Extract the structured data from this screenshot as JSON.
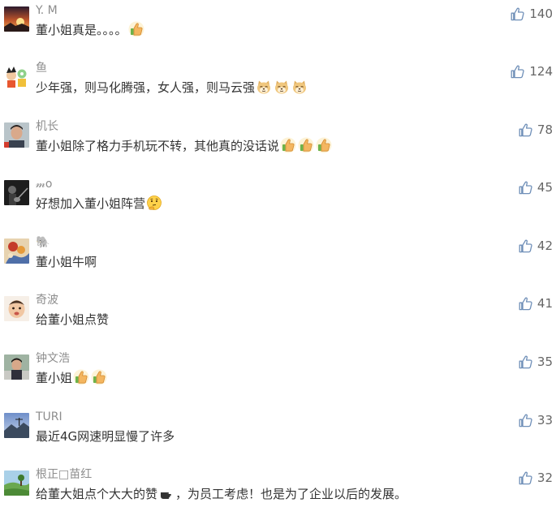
{
  "comments": [
    {
      "author": "Y. M",
      "avatar": "sunset-avatar",
      "content": [
        {
          "t": "text",
          "v": "董小姐真是。。。。"
        },
        {
          "t": "emoji",
          "v": "thumbs-up"
        }
      ],
      "likes": "140"
    },
    {
      "author": "鱼",
      "avatar": "cartoon-avatar",
      "content": [
        {
          "t": "text",
          "v": "少年强，则马化腾强，女人强，则马云强"
        },
        {
          "t": "emoji",
          "v": "doge"
        },
        {
          "t": "emoji",
          "v": "doge"
        },
        {
          "t": "emoji",
          "v": "doge"
        }
      ],
      "likes": "124"
    },
    {
      "author": "机长",
      "avatar": "man-portrait-avatar",
      "content": [
        {
          "t": "text",
          "v": "董小姐除了格力手机玩不转，其他真的没话说"
        },
        {
          "t": "emoji",
          "v": "thumbs-up"
        },
        {
          "t": "emoji",
          "v": "thumbs-up"
        },
        {
          "t": "emoji",
          "v": "thumbs-up"
        }
      ],
      "likes": "78"
    },
    {
      "author": "𝓂o",
      "avatar": "dark-guitar-avatar",
      "content": [
        {
          "t": "text",
          "v": "好想加入董小姐阵营"
        },
        {
          "t": "emoji",
          "v": "thinking-face"
        }
      ],
      "likes": "45"
    },
    {
      "author": "🐘",
      "avatar": "illustration-avatar",
      "content": [
        {
          "t": "text",
          "v": "董小姐牛啊"
        }
      ],
      "likes": "42"
    },
    {
      "author": "奇波",
      "avatar": "baby-avatar",
      "content": [
        {
          "t": "text",
          "v": "给董小姐点赞"
        }
      ],
      "likes": "41"
    },
    {
      "author": "钟文浩",
      "avatar": "child-avatar",
      "content": [
        {
          "t": "text",
          "v": "董小姐"
        },
        {
          "t": "emoji",
          "v": "thumbs-up"
        },
        {
          "t": "emoji",
          "v": "thumbs-up"
        }
      ],
      "likes": "35"
    },
    {
      "author": "TURI",
      "avatar": "landscape-avatar",
      "content": [
        {
          "t": "text",
          "v": "最近4G网速明显慢了许多"
        }
      ],
      "likes": "33"
    },
    {
      "author": "根正□苗红",
      "avatar": "countryside-avatar",
      "content": [
        {
          "t": "text",
          "v": "给董大姐点个大大的赞"
        },
        {
          "t": "emoji",
          "v": "pointing-hand"
        },
        {
          "t": "text",
          "v": "，为员工考虑！也是为了企业以后的发展。"
        }
      ],
      "likes": "32"
    }
  ],
  "colors": {
    "name": "#8d8d8d",
    "text": "#333333",
    "likes": "#666666",
    "like_icon": "#6f8fb8"
  }
}
